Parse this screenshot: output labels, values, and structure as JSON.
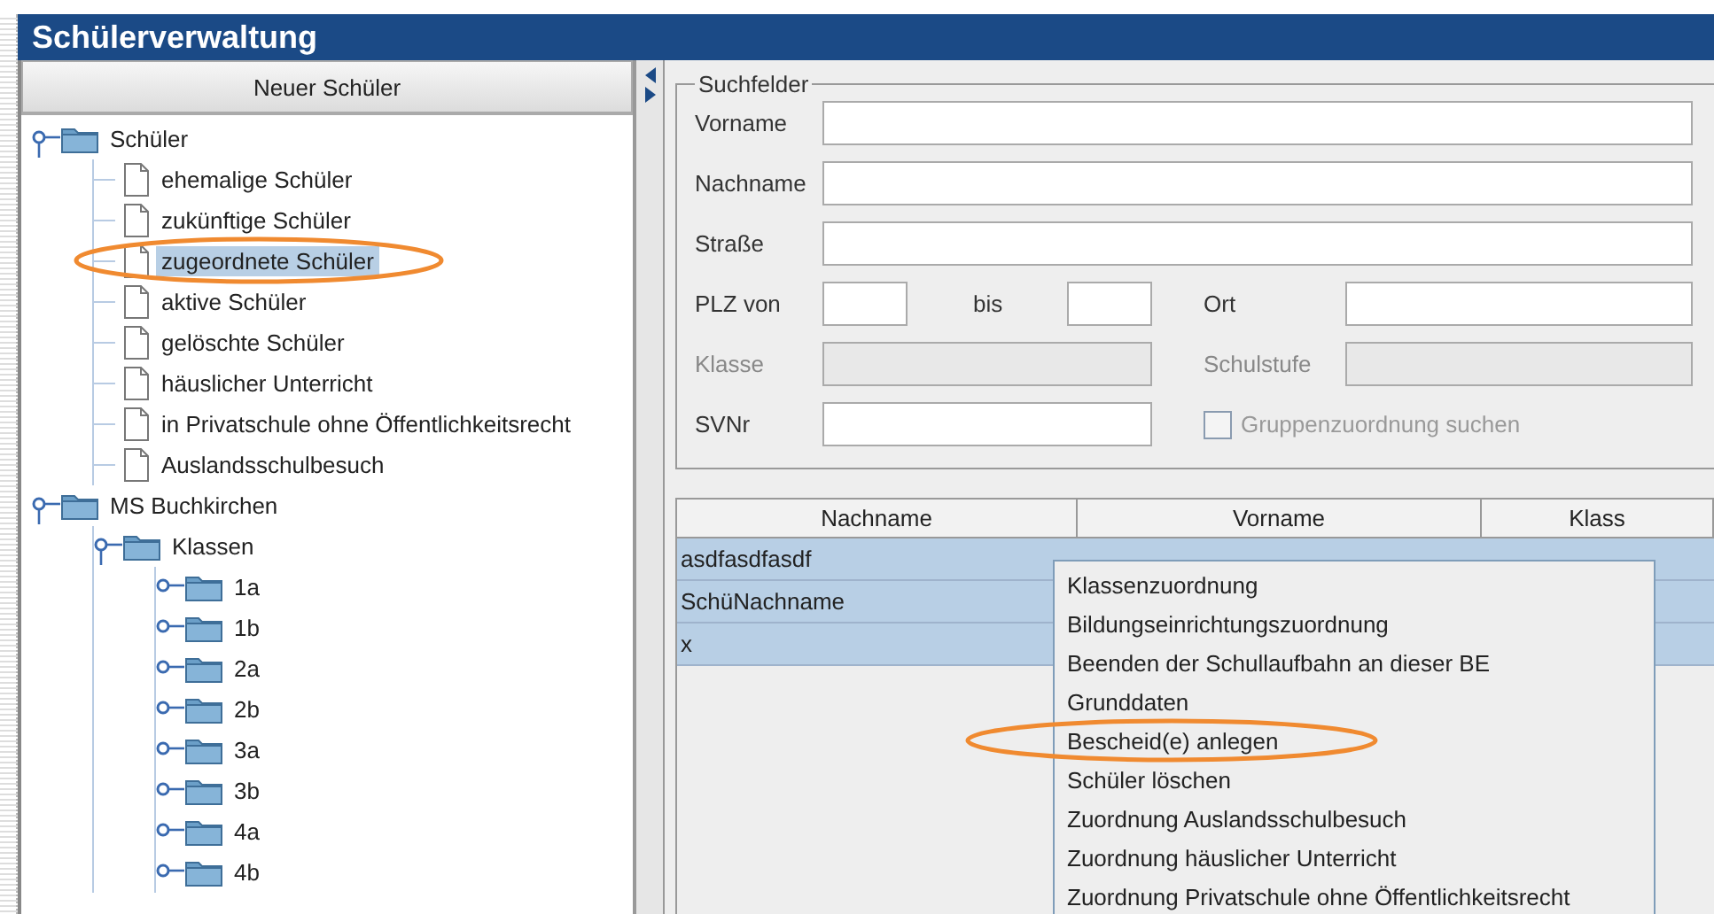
{
  "window": {
    "title": "Schülerverwaltung"
  },
  "new_button": {
    "label": "Neuer Schüler"
  },
  "tree": [
    {
      "label": "Schüler",
      "kind": "folder",
      "expanded": true,
      "selected": false,
      "children": [
        {
          "label": "ehemalige Schüler",
          "kind": "file",
          "selected": false
        },
        {
          "label": "zukünftige Schüler",
          "kind": "file",
          "selected": false
        },
        {
          "label": "zugeordnete Schüler",
          "kind": "file",
          "selected": true
        },
        {
          "label": "aktive Schüler",
          "kind": "file",
          "selected": false
        },
        {
          "label": "gelöschte Schüler",
          "kind": "file",
          "selected": false
        },
        {
          "label": "häuslicher Unterricht",
          "kind": "file",
          "selected": false
        },
        {
          "label": "in Privatschule ohne Öffentlichkeitsrecht",
          "kind": "file",
          "selected": false
        },
        {
          "label": "Auslandsschulbesuch",
          "kind": "file",
          "selected": false
        }
      ]
    },
    {
      "label": "MS Buchkirchen",
      "kind": "folder",
      "expanded": true,
      "selected": false,
      "children": [
        {
          "label": "Klassen",
          "kind": "folder",
          "expanded": true,
          "selected": false,
          "children": [
            {
              "label": "1a",
              "kind": "folder",
              "expanded": false,
              "selected": false
            },
            {
              "label": "1b",
              "kind": "folder",
              "expanded": false,
              "selected": false
            },
            {
              "label": "2a",
              "kind": "folder",
              "expanded": false,
              "selected": false
            },
            {
              "label": "2b",
              "kind": "folder",
              "expanded": false,
              "selected": false
            },
            {
              "label": "3a",
              "kind": "folder",
              "expanded": false,
              "selected": false
            },
            {
              "label": "3b",
              "kind": "folder",
              "expanded": false,
              "selected": false
            },
            {
              "label": "4a",
              "kind": "folder",
              "expanded": false,
              "selected": false
            },
            {
              "label": "4b",
              "kind": "folder",
              "expanded": false,
              "selected": false
            }
          ]
        }
      ]
    }
  ],
  "search": {
    "title": "Suchfelder",
    "rows": [
      {
        "kind": "full",
        "label": "Vorname",
        "disabled": false
      },
      {
        "kind": "full",
        "label": "Nachname",
        "disabled": false
      },
      {
        "kind": "full",
        "label": "Straße",
        "disabled": false
      },
      {
        "kind": "range",
        "label": "PLZ von",
        "to_label": "bis",
        "side_label": "Ort",
        "disabled": false
      },
      {
        "kind": "pair",
        "label": "Klasse",
        "side_label": "Schulstufe",
        "disabled": true
      },
      {
        "kind": "check",
        "label": "SVNr",
        "check_label": "Gruppenzuordnung suchen",
        "checked": false,
        "disabled": false,
        "check_disabled": true
      }
    ]
  },
  "table": {
    "columns": [
      "Nachname",
      "Vorname",
      "Klass"
    ],
    "rows": [
      {
        "cells": [
          "asdfasdfasdf",
          "",
          ""
        ],
        "selected": true
      },
      {
        "cells": [
          "SchüNachname",
          "",
          ""
        ],
        "selected": true
      },
      {
        "cells": [
          "x",
          "",
          ""
        ],
        "selected": true
      }
    ]
  },
  "context_menu": {
    "items": [
      "Klassenzuordnung",
      "Bildungseinrichtungszuordnung",
      "Beenden der Schullaufbahn an dieser BE",
      "Grunddaten",
      "Bescheid(e) anlegen",
      "Schüler löschen",
      "Zuordnung Auslandsschulbesuch",
      "Zuordnung häuslicher Unterricht",
      "Zuordnung Privatschule ohne Öffentlichkeitsrecht"
    ]
  }
}
